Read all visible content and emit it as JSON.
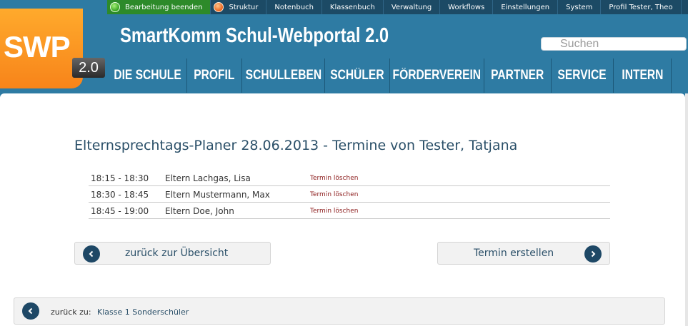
{
  "topbar": {
    "items": [
      {
        "label": "Bearbeitung beenden",
        "icon": "green-status-icon"
      },
      {
        "label": "Struktur",
        "icon": "orange-status-icon"
      },
      {
        "label": "Notenbuch"
      },
      {
        "label": "Klassenbuch"
      },
      {
        "label": "Verwaltung"
      },
      {
        "label": "Workflows"
      },
      {
        "label": "Einstellungen"
      },
      {
        "label": "System"
      },
      {
        "label": "Profil Tester, Theo"
      }
    ]
  },
  "header": {
    "logo_text": "SWP",
    "logo_version": "2.0",
    "site_title": "SmartKomm Schul-Webportal 2.0",
    "search_placeholder": "Suchen"
  },
  "mainnav": {
    "items": [
      {
        "label": "DIE SCHULE"
      },
      {
        "label": "PROFIL"
      },
      {
        "label": "SCHULLEBEN"
      },
      {
        "label": "SCHÜLER"
      },
      {
        "label": "FÖRDERVEREIN"
      },
      {
        "label": "PARTNER"
      },
      {
        "label": "SERVICE"
      },
      {
        "label": "INTERN"
      }
    ]
  },
  "main": {
    "title": "Elternsprechtags-Planer 28.06.2013 - Termine von Tester, Tatjana",
    "appointments": [
      {
        "time": "18:15 - 18:30",
        "who": "Eltern Lachgas, Lisa",
        "action": "Termin löschen"
      },
      {
        "time": "18:30 - 18:45",
        "who": "Eltern Mustermann, Max",
        "action": "Termin löschen"
      },
      {
        "time": "18:45 - 19:00",
        "who": "Eltern Doe, John",
        "action": "Termin löschen"
      }
    ],
    "back_button": "zurück zur Übersicht",
    "create_button": "Termin erstellen",
    "back_prefix": "zurück zu:",
    "back_link": "Klasse 1 Sonderschüler"
  },
  "colors": {
    "header_blue": "#2e7ba3",
    "topbar_dark": "#1c4a65",
    "logo_orange": "#f7841a",
    "accent_navy": "#1e4866",
    "delete_red": "#8b1a1a"
  }
}
